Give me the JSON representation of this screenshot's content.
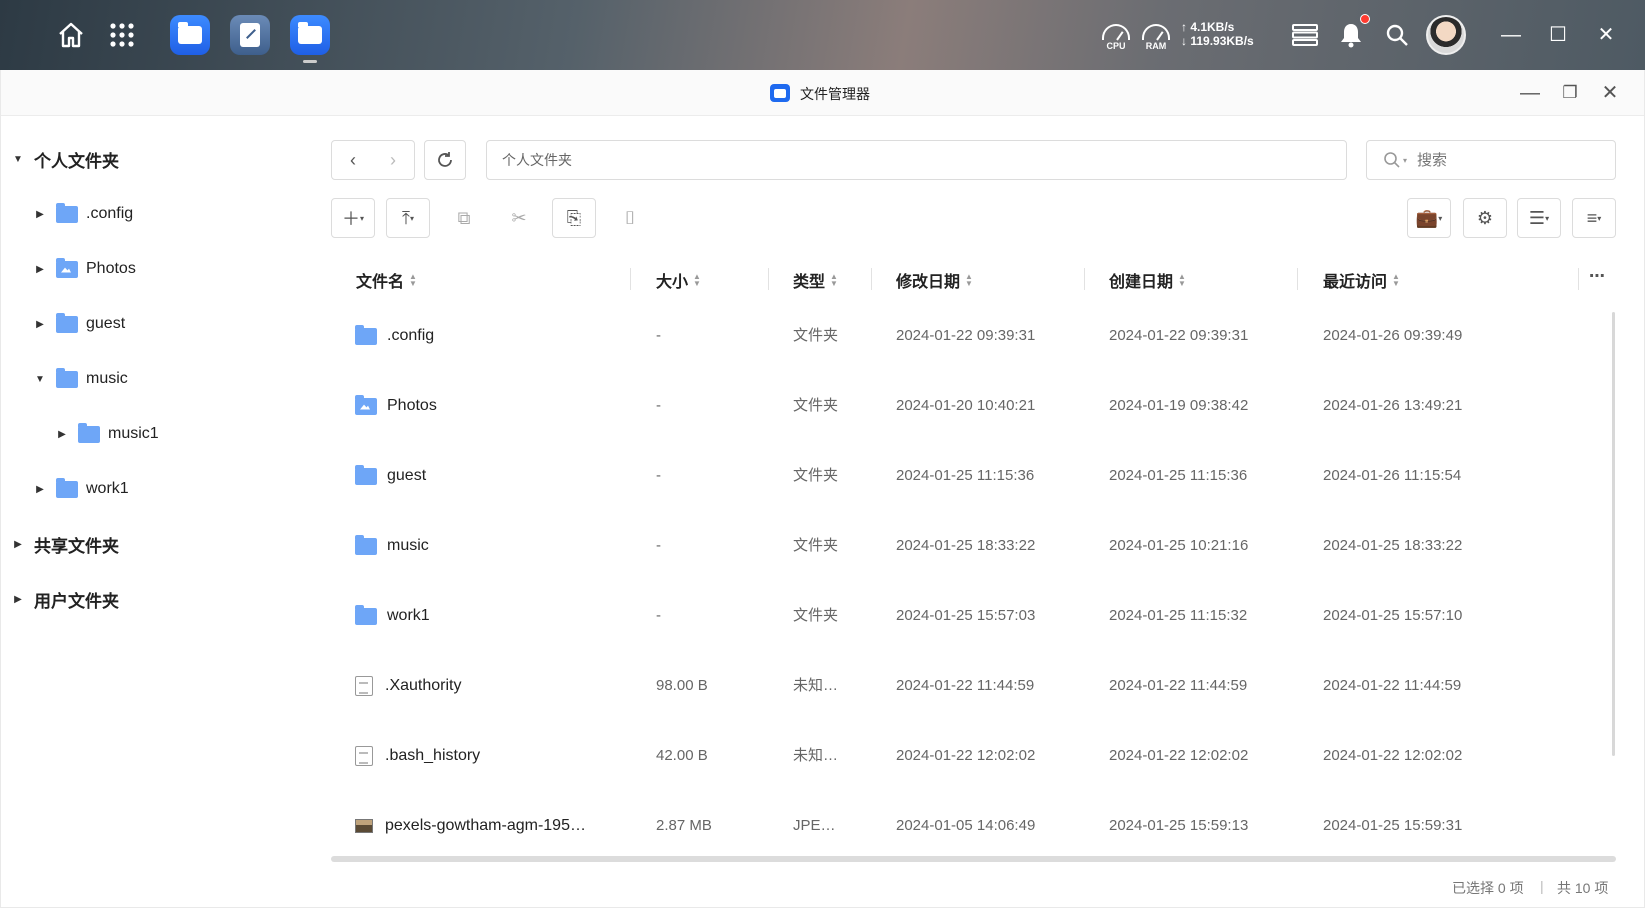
{
  "desktop": {
    "cpu_label": "CPU",
    "ram_label": "RAM",
    "upload": "↑ 4.1KB/s",
    "download": "↓ 119.93KB/s"
  },
  "window": {
    "title": "文件管理器"
  },
  "sidebar": {
    "personal": "个人文件夹",
    "items": [
      ".config",
      "Photos",
      "guest",
      "music",
      "music1",
      "work1"
    ],
    "shared": "共享文件夹",
    "users": "用户文件夹"
  },
  "toolbar": {
    "address": "个人文件夹",
    "search_placeholder": "搜索"
  },
  "table": {
    "headers": [
      "文件名",
      "大小",
      "类型",
      "修改日期",
      "创建日期",
      "最近访问"
    ],
    "rows": [
      {
        "name": ".config",
        "size": "-",
        "type": "文件夹",
        "modified": "2024-01-22 09:39:31",
        "created": "2024-01-22 09:39:31",
        "accessed": "2024-01-26 09:39:49",
        "icon": "folder"
      },
      {
        "name": "Photos",
        "size": "-",
        "type": "文件夹",
        "modified": "2024-01-20 10:40:21",
        "created": "2024-01-19 09:38:42",
        "accessed": "2024-01-26 13:49:21",
        "icon": "photo-folder"
      },
      {
        "name": "guest",
        "size": "-",
        "type": "文件夹",
        "modified": "2024-01-25 11:15:36",
        "created": "2024-01-25 11:15:36",
        "accessed": "2024-01-26 11:15:54",
        "icon": "folder"
      },
      {
        "name": "music",
        "size": "-",
        "type": "文件夹",
        "modified": "2024-01-25 18:33:22",
        "created": "2024-01-25 10:21:16",
        "accessed": "2024-01-25 18:33:22",
        "icon": "folder"
      },
      {
        "name": "work1",
        "size": "-",
        "type": "文件夹",
        "modified": "2024-01-25 15:57:03",
        "created": "2024-01-25 11:15:32",
        "accessed": "2024-01-25 15:57:10",
        "icon": "folder"
      },
      {
        "name": ".Xauthority",
        "size": "98.00 B",
        "type": "未知…",
        "modified": "2024-01-22 11:44:59",
        "created": "2024-01-22 11:44:59",
        "accessed": "2024-01-22 11:44:59",
        "icon": "file"
      },
      {
        "name": ".bash_history",
        "size": "42.00 B",
        "type": "未知…",
        "modified": "2024-01-22 12:02:02",
        "created": "2024-01-22 12:02:02",
        "accessed": "2024-01-22 12:02:02",
        "icon": "file"
      },
      {
        "name": "pexels-gowtham-agm-195…",
        "size": "2.87 MB",
        "type": "JPE…",
        "modified": "2024-01-05 14:06:49",
        "created": "2024-01-25 15:59:13",
        "accessed": "2024-01-25 15:59:31",
        "icon": "image"
      }
    ]
  },
  "status": {
    "selected": "已选择 0 项",
    "separator": "|",
    "total": "共 10 项"
  }
}
